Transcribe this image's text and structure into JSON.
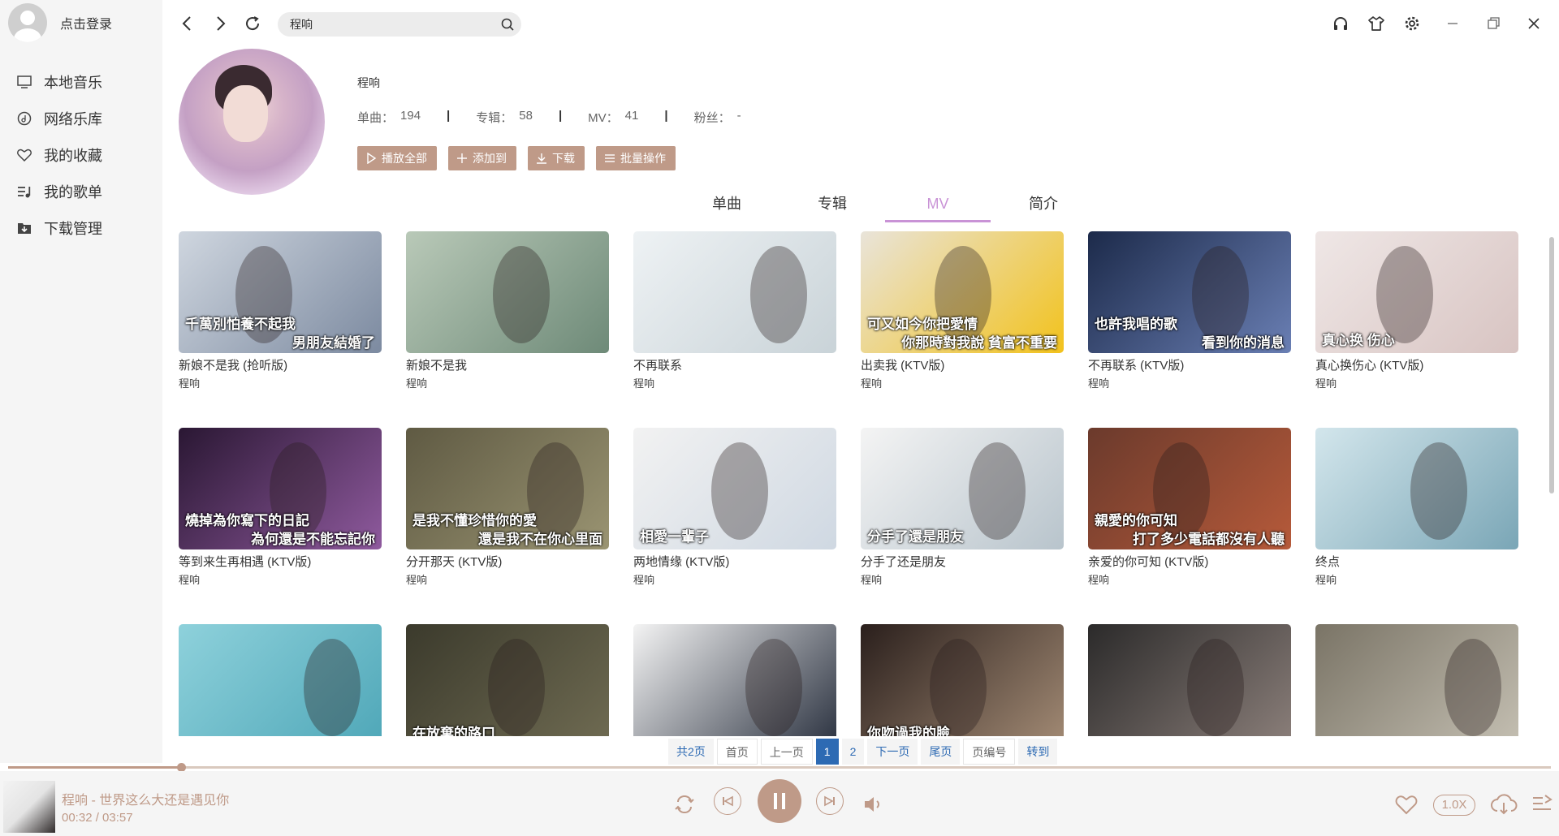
{
  "user": {
    "login_label": "点击登录"
  },
  "sidebar": {
    "items": [
      {
        "label": "本地音乐",
        "icon": "monitor-icon"
      },
      {
        "label": "网络乐库",
        "icon": "music-disc-icon"
      },
      {
        "label": "我的收藏",
        "icon": "heart-icon"
      },
      {
        "label": "我的歌单",
        "icon": "playlist-icon"
      },
      {
        "label": "下载管理",
        "icon": "download-box-icon"
      }
    ]
  },
  "search": {
    "value": "程响",
    "placeholder": ""
  },
  "artist": {
    "name": "程响",
    "stats": [
      {
        "label": "单曲：",
        "value": "194"
      },
      {
        "label": "专辑：",
        "value": "58"
      },
      {
        "label": "MV：",
        "value": "41"
      },
      {
        "label": "粉丝：",
        "value": "-"
      }
    ]
  },
  "actions": {
    "play_all": "播放全部",
    "add_to": "添加到",
    "download": "下载",
    "batch": "批量操作"
  },
  "tabs": [
    {
      "label": "单曲",
      "active": false
    },
    {
      "label": "专辑",
      "active": false
    },
    {
      "label": "MV",
      "active": true
    },
    {
      "label": "简介",
      "active": false
    }
  ],
  "mvs": [
    {
      "title": "新娘不是我 (抢听版)",
      "artist": "程响",
      "caption": "千萬別怕養不起我",
      "caption2": "男朋友結婚了",
      "colors": [
        "#cfd6df",
        "#7c8aa0"
      ]
    },
    {
      "title": "新娘不是我",
      "artist": "程响",
      "caption": "",
      "caption2": "",
      "colors": [
        "#b9c9b8",
        "#6e8a78"
      ]
    },
    {
      "title": "不再联系",
      "artist": "程响",
      "caption": "",
      "caption2": "",
      "colors": [
        "#eef2f4",
        "#c9d3d8"
      ]
    },
    {
      "title": "出卖我 (KTV版)",
      "artist": "程响",
      "caption": "可又如今你把愛情",
      "caption2": "你那時對我說 貧富不重要",
      "colors": [
        "#e9e4da",
        "#f2c21c"
      ]
    },
    {
      "title": "不再联系 (KTV版)",
      "artist": "程响",
      "caption": "也許我唱的歌",
      "caption2": "看到你的消息",
      "colors": [
        "#1c2a4a",
        "#6a7fb4"
      ]
    },
    {
      "title": "真心换伤心 (KTV版)",
      "artist": "程响",
      "caption": "真心换 伤心",
      "caption2": "",
      "colors": [
        "#efe7e6",
        "#d8c4c2"
      ]
    },
    {
      "title": "等到来生再相遇 (KTV版)",
      "artist": "程响",
      "caption": "燒掉為你寫下的日記",
      "caption2": "為何還是不能忘記你",
      "colors": [
        "#2a1733",
        "#8f5a9e"
      ]
    },
    {
      "title": "分开那天 (KTV版)",
      "artist": "程响",
      "caption": "是我不懂珍惜你的愛",
      "caption2": "還是我不在你心里面",
      "colors": [
        "#5f5a43",
        "#9a9472"
      ]
    },
    {
      "title": "两地情缘 (KTV版)",
      "artist": "程响",
      "caption": "相愛一輩子",
      "caption2": "",
      "colors": [
        "#f2f2f2",
        "#cfd8e2"
      ]
    },
    {
      "title": "分手了还是朋友",
      "artist": "程响",
      "caption": "分手了還是朋友",
      "caption2": "",
      "colors": [
        "#f4f4f4",
        "#b8c4cc"
      ]
    },
    {
      "title": "亲爱的你可知 (KTV版)",
      "artist": "程响",
      "caption": "親愛的你可知",
      "caption2": "打了多少電話都沒有人聽",
      "colors": [
        "#6b3a2c",
        "#b65a3a"
      ]
    },
    {
      "title": "终点",
      "artist": "程响",
      "caption": "",
      "caption2": "",
      "colors": [
        "#d3e6ec",
        "#7aa6b6"
      ]
    },
    {
      "title": "",
      "artist": "",
      "caption": "",
      "caption2": "",
      "colors": [
        "#8ed1db",
        "#4fa7b8"
      ]
    },
    {
      "title": "",
      "artist": "",
      "caption": "在放棄的路口",
      "caption2": "",
      "colors": [
        "#3b3a2c",
        "#6f6b52"
      ]
    },
    {
      "title": "",
      "artist": "",
      "caption": "",
      "caption2": "",
      "colors": [
        "#f4f4f4",
        "#2b3240"
      ]
    },
    {
      "title": "",
      "artist": "",
      "caption": "你吻過我的臉",
      "caption2": "",
      "colors": [
        "#2a1f1c",
        "#a28a74"
      ]
    },
    {
      "title": "",
      "artist": "",
      "caption": "",
      "caption2": "",
      "colors": [
        "#2b2a2a",
        "#8b7f7a"
      ]
    },
    {
      "title": "",
      "artist": "",
      "caption": "",
      "caption2": "",
      "colors": [
        "#7a7466",
        "#c4bfb2"
      ]
    }
  ],
  "pager": {
    "total": "共2页",
    "first": "首页",
    "prev": "上一页",
    "pages": [
      "1",
      "2"
    ],
    "current": "1",
    "next": "下一页",
    "last": "尾页",
    "page_no": "页编号",
    "goto": "转到"
  },
  "player": {
    "track": "程响 - 世界这么大还是遇见你",
    "time": "00:32 / 03:57",
    "progress": 0.1123,
    "speed": "1.0X"
  },
  "colors": {
    "accent": "#bf9a88",
    "tab_active": "#c993d6",
    "link": "#2d6ab3"
  }
}
